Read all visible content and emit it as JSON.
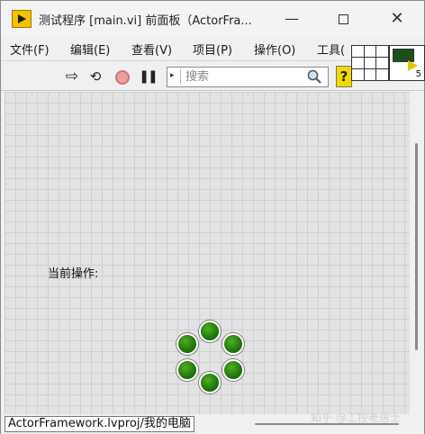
{
  "window": {
    "title": "测试程序 [main.vi] 前面板（ActorFra...",
    "minimize_glyph": "—",
    "close_glyph": "✕"
  },
  "menu": {
    "items": [
      "文件(F)",
      "编辑(E)",
      "查看(V)",
      "项目(P)",
      "操作(O)",
      "工具("
    ]
  },
  "toolbar": {
    "run_icon": "run-arrow-icon",
    "run_continuously_icon": "run-continuously-icon",
    "abort_icon": "abort-icon",
    "pause_icon": "pause-icon",
    "search_placeholder": "搜索",
    "help_label": "?"
  },
  "vi_icon": {
    "number": "5"
  },
  "panel": {
    "operation_label": "当前操作:",
    "spinner": {
      "led_count": 6,
      "led_color": "#237a0e"
    }
  },
  "status": {
    "project_path": "ActorFramework.lvproj/我的电脑"
  },
  "watermark": "知乎 @工控老居士"
}
